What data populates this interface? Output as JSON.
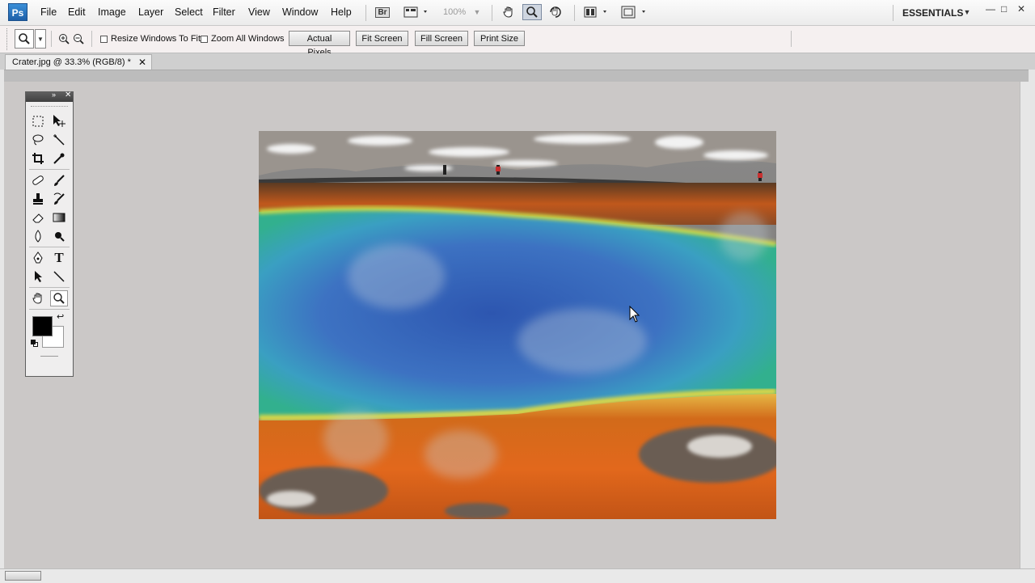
{
  "app": {
    "logo_text": "Ps"
  },
  "menu": [
    "File",
    "Edit",
    "Image",
    "Layer",
    "Select",
    "Filter",
    "View",
    "Window",
    "Help"
  ],
  "toolbar": {
    "bridge_label": "Br",
    "zoom_level": "100%",
    "workspace": "ESSENTIALS",
    "icons": [
      "bridge-icon",
      "view-extras-icon",
      "hand-icon",
      "zoom-icon",
      "rotate-view-icon",
      "arrange-documents-icon",
      "screen-mode-icon"
    ]
  },
  "options": {
    "resize_windows": "Resize Windows To Fit",
    "zoom_all": "Zoom All Windows",
    "actual_pixels": "Actual Pixels",
    "fit_screen": "Fit Screen",
    "fill_screen": "Fill Screen",
    "print_size": "Print Size"
  },
  "document": {
    "tab_title": "Crater.jpg @ 33.3% (RGB/8) *"
  },
  "tools": [
    "rectangular-marquee-icon",
    "move-icon",
    "lasso-icon",
    "magic-wand-icon",
    "crop-icon",
    "eyedropper-icon",
    "healing-brush-icon",
    "brush-icon",
    "clone-stamp-icon",
    "history-brush-icon",
    "eraser-icon",
    "gradient-icon",
    "blur-icon",
    "dodge-icon",
    "pen-icon",
    "type-icon",
    "path-selection-icon",
    "line-icon",
    "hand-tool-icon",
    "zoom-tool-icon"
  ],
  "colors": {
    "foreground": "#000000",
    "background": "#ffffff",
    "accent": "#1e5fa8"
  }
}
